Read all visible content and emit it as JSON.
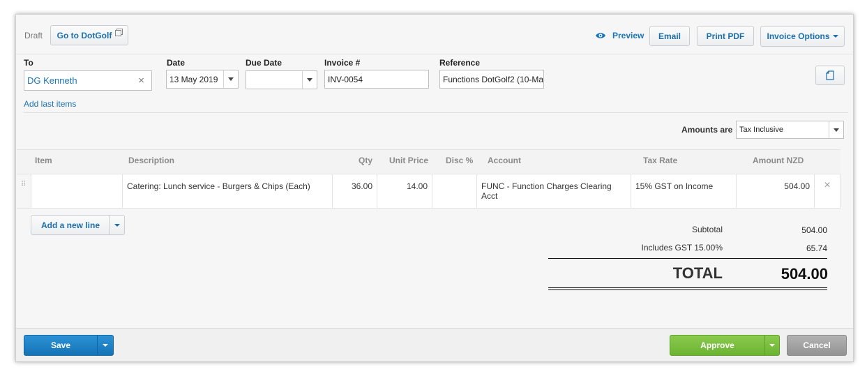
{
  "header": {
    "status": "Draft",
    "go_to_contact": "Go to DotGolf",
    "preview": "Preview",
    "email": "Email",
    "print_pdf": "Print PDF",
    "invoice_options": "Invoice Options"
  },
  "form": {
    "to_label": "To",
    "to_value": "DG Kenneth",
    "date_label": "Date",
    "date_value": "13 May 2019",
    "due_date_label": "Due Date",
    "due_date_value": "",
    "invoice_label": "Invoice #",
    "invoice_value": "INV-0054",
    "reference_label": "Reference",
    "reference_value": "Functions DotGolf2 (10-Ma",
    "add_last_items": "Add last items",
    "amounts_are_label": "Amounts are",
    "amounts_are_value": "Tax Inclusive"
  },
  "table": {
    "headers": {
      "item": "Item",
      "description": "Description",
      "qty": "Qty",
      "unit_price": "Unit Price",
      "disc": "Disc %",
      "account": "Account",
      "tax_rate": "Tax Rate",
      "amount": "Amount NZD"
    },
    "rows": [
      {
        "item": "",
        "description": "Catering: Lunch service - Burgers & Chips (Each)",
        "qty": "36.00",
        "unit_price": "14.00",
        "disc": "",
        "account": "FUNC - Function Charges Clearing Acct",
        "tax_rate": "15% GST on Income",
        "amount": "504.00"
      }
    ]
  },
  "add_new_line": "Add a new line",
  "totals": {
    "subtotal_label": "Subtotal",
    "subtotal_value": "504.00",
    "gst_label": "Includes GST 15.00%",
    "gst_value": "65.74",
    "total_label": "TOTAL",
    "total_value": "504.00"
  },
  "footer": {
    "save": "Save",
    "approve": "Approve",
    "cancel": "Cancel"
  },
  "colors": {
    "link_blue": "#1c74b9",
    "save_blue": "#1a7ec1",
    "approve_green": "#7ac143",
    "cancel_gray": "#9a9a9a"
  },
  "icons": {
    "external": "external-link-icon",
    "eye": "eye-icon",
    "clear": "close-icon",
    "copy": "document-icon",
    "drag": "drag-handle-icon",
    "delete": "delete-row-icon"
  }
}
